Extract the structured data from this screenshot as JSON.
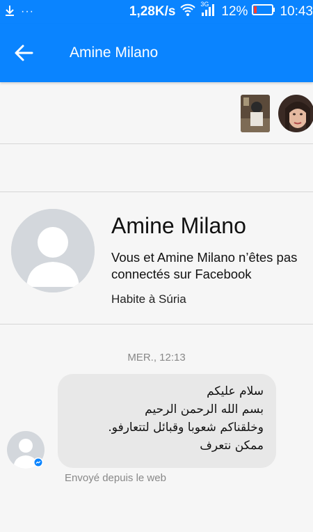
{
  "status_bar": {
    "speed": "1,28K/s",
    "network": "3G",
    "battery": "12%",
    "time": "10:43",
    "left_icons": [
      "download-icon",
      "more-icon"
    ]
  },
  "app_bar": {
    "title": "Amine Milano",
    "color": "#0a84ff"
  },
  "profile": {
    "name": "Amine Milano",
    "subtitle": "Vous et Amine Milano n’êtes pas connectés sur Facebook",
    "location": "Habite à Súria"
  },
  "conversation": {
    "timestamp": "MER., 12:13",
    "message_lines": [
      "سلام عليكم",
      "بسم الله الرحمن الرحيم",
      "وخلقناكم شعوبا وقبائل لتتعارفو.",
      "ممكن نتعرف"
    ],
    "sent_via": "Envoyé depuis le web"
  }
}
